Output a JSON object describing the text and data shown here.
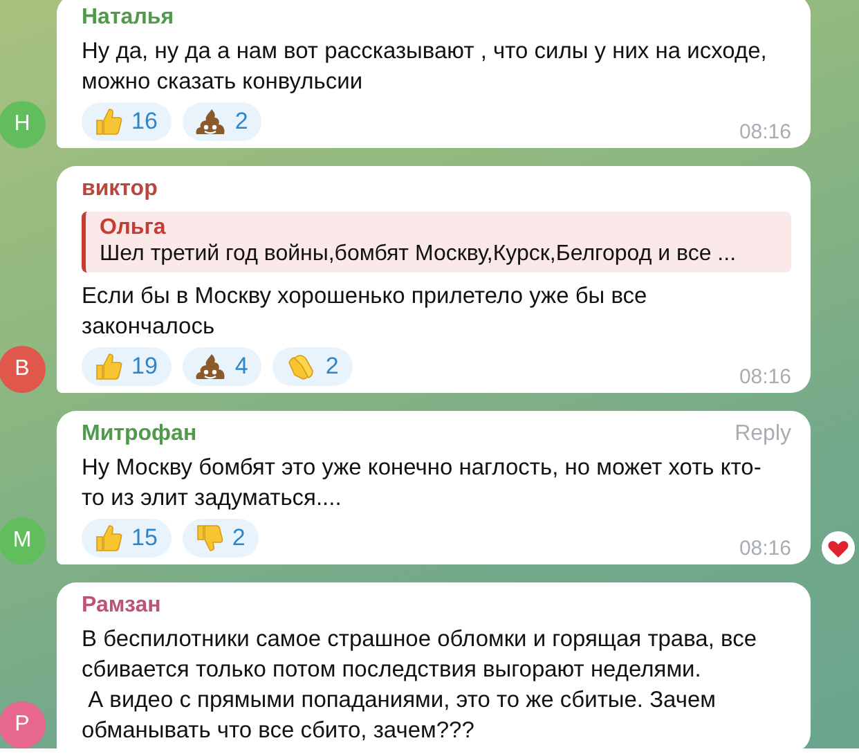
{
  "messages": [
    {
      "author": "Наталья",
      "avatar": {
        "letter": "Н",
        "color": "#62bd5c"
      },
      "text": "Ну да, ну да а нам вот рассказывают , что силы у них на исходе,\nможно сказать конвульсии",
      "reactions": [
        {
          "kind": "thumbs_up",
          "count": "16"
        },
        {
          "kind": "poop",
          "count": "2"
        }
      ],
      "time": "08:16",
      "reacted": false
    },
    {
      "author": "виктор",
      "avatar": {
        "letter": "В",
        "color": "#e0584c"
      },
      "quote": {
        "author": "Ольга",
        "text": "Шел третий год войны,бомбят Москву,Курск,Белгород и все ..."
      },
      "text": "Если бы в Москву хорошенько прилетело уже бы все\nзакончалось",
      "reactions": [
        {
          "kind": "thumbs_up",
          "count": "19"
        },
        {
          "kind": "poop",
          "count": "4"
        },
        {
          "kind": "clap",
          "count": "2"
        }
      ],
      "time": "08:16",
      "reacted": false
    },
    {
      "author": "Митрофан",
      "avatar": {
        "letter": "М",
        "color": "#62bd5c"
      },
      "reply_label": "Reply",
      "text": "Ну Москву бомбят это уже конечно наглость, но может хоть кто-\nто из элит задуматься....",
      "reactions": [
        {
          "kind": "thumbs_up",
          "count": "15"
        },
        {
          "kind": "thumbs_down",
          "count": "2"
        }
      ],
      "time": "08:16",
      "reacted": true
    },
    {
      "author": "Рамзан",
      "avatar": {
        "letter": "Р",
        "color": "#e8678e"
      },
      "text": "В беспилотники самое страшное обломки и горящая трава, все\nсбивается только потом последствия выгорают неделями.\n А видео с прямыми попаданиями, это то же сбитые. Зачем\nобманывать что все сбито, зачем???",
      "reacted": false
    }
  ]
}
